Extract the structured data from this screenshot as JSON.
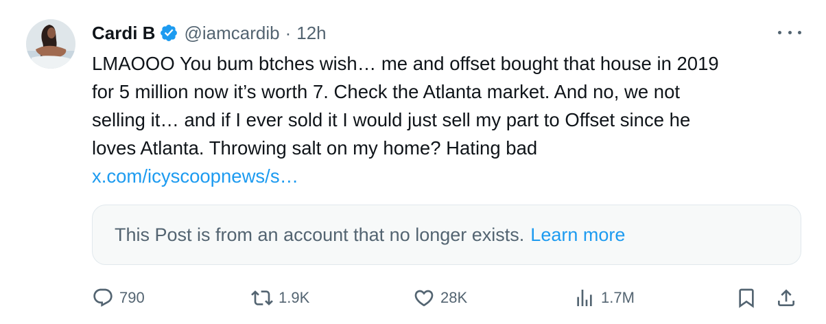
{
  "tweet": {
    "author": {
      "display_name": "Cardi B",
      "handle": "@iamcardib",
      "separator": "·",
      "time": "12h",
      "verified": true,
      "avatar_icon": "profile-photo"
    },
    "text_lines": [
      "LMAOOO You bum btches wish… me and offset bought that house in 2019",
      "for 5 million now it’s worth 7. Check the Atlanta market. And no, we not",
      "selling it… and if I ever sold it I would just sell my part to Offset since he",
      "loves Atlanta. Throwing salt on my home? Hating bad"
    ],
    "link": "x.com/icyscoopnews/s…",
    "quoted_notice": {
      "text": "This Post is from an account that no longer exists.",
      "learn_more": "Learn more"
    },
    "actions": {
      "replies": "790",
      "reposts": "1.9K",
      "likes": "28K",
      "views": "1.7M"
    }
  },
  "colors": {
    "text_primary": "#0f1419",
    "text_secondary": "#536471",
    "accent": "#1d9bf0",
    "verified": "#1d9bf0",
    "notice_background": "#f7f9f9"
  },
  "icons": [
    "verified-badge-icon",
    "more-options-icon",
    "reply-icon",
    "repost-icon",
    "like-icon",
    "views-icon",
    "bookmark-icon",
    "share-icon"
  ]
}
